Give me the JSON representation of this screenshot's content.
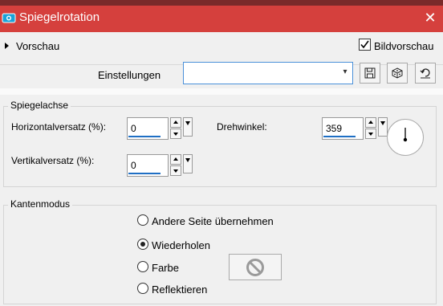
{
  "window": {
    "title": "Spiegelrotation",
    "close_icon": "close-icon",
    "app_icon": "camera-icon",
    "title_color": "#d5403d"
  },
  "preview": {
    "label": "Vorschau",
    "checkbox_label": "Bildvorschau",
    "checkbox_checked": true
  },
  "settings": {
    "label": "Einstellungen",
    "preset_value": "",
    "buttons": [
      "save-icon",
      "random-dice-icon",
      "reset-icon"
    ]
  },
  "mirror_axis": {
    "title": "Spiegelachse",
    "horizontal_label": "Horizontalversatz (%):",
    "horizontal_value": "0",
    "vertical_label": "Vertikalversatz (%):",
    "vertical_value": "0",
    "angle_label": "Drehwinkel:",
    "angle_value": "359"
  },
  "edge_mode": {
    "title": "Kantenmodus",
    "options": [
      {
        "label": "Andere Seite übernehmen",
        "selected": false
      },
      {
        "label": "Wiederholen",
        "selected": true
      },
      {
        "label": "Farbe",
        "selected": false
      },
      {
        "label": "Reflektieren",
        "selected": false
      }
    ],
    "color_swatch_icon": "no-color-icon"
  },
  "accent_color": "#1f6fc4"
}
